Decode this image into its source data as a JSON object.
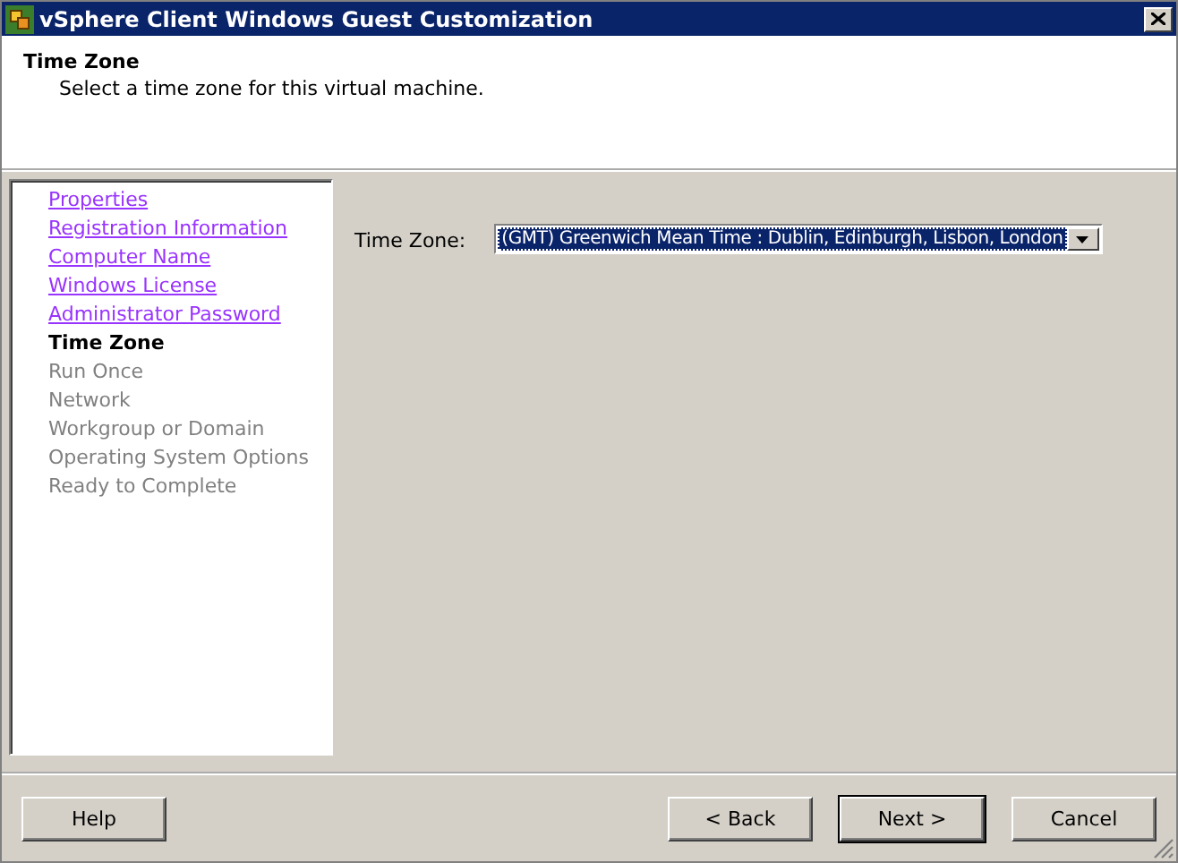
{
  "window": {
    "title": "vSphere Client Windows Guest Customization"
  },
  "header": {
    "title": "Time Zone",
    "subtitle": "Select a time zone for this virtual machine."
  },
  "steps": [
    {
      "label": "Properties",
      "kind": "link"
    },
    {
      "label": "Registration Information",
      "kind": "link"
    },
    {
      "label": "Computer Name",
      "kind": "link"
    },
    {
      "label": "Windows License",
      "kind": "link"
    },
    {
      "label": "Administrator Password",
      "kind": "link"
    },
    {
      "label": "Time Zone",
      "kind": "current"
    },
    {
      "label": "Run Once",
      "kind": "pending"
    },
    {
      "label": "Network",
      "kind": "pending"
    },
    {
      "label": "Workgroup or Domain",
      "kind": "pending"
    },
    {
      "label": "Operating System Options",
      "kind": "pending"
    },
    {
      "label": "Ready to Complete",
      "kind": "pending"
    }
  ],
  "form": {
    "label": "Time Zone:",
    "value": "(GMT) Greenwich Mean Time : Dublin, Edinburgh, Lisbon, London"
  },
  "buttons": [
    {
      "label": "Help",
      "default": false
    },
    {
      "label": "< Back",
      "default": false
    },
    {
      "label": "Next >",
      "default": true
    },
    {
      "label": "Cancel",
      "default": false
    }
  ]
}
